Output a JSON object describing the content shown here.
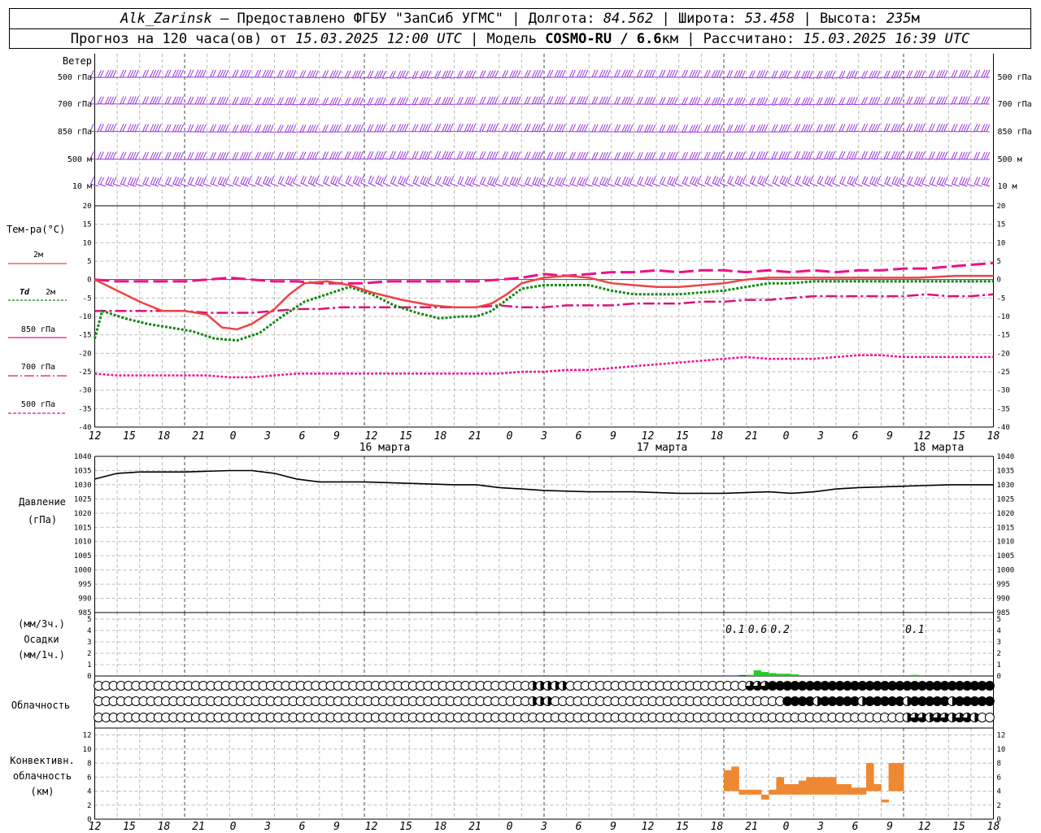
{
  "header": {
    "station": "Alk_Zarinsk",
    "provider": " – Предоставлено ФГБУ \"ЗапСиб УГМС\" | Долгота: ",
    "lon": "84.562",
    "lat_label": " | Широта: ",
    "lat": "53.458",
    "alt_label": " | Высота: ",
    "alt": "235",
    "alt_unit": "м",
    "forecast_label": "Прогноз на 120 часа(ов) от ",
    "start": "15.03.2025 12:00 UTC",
    "model_label": "  | Модель ",
    "model": "COSMO-RU / 6.6",
    "model_unit": "км",
    "calc_label": " | Рассчитано: ",
    "calc": "15.03.2025 16:39 UTC"
  },
  "labels": {
    "wind": "Ветер",
    "levels": [
      "500 гПа",
      "700 гПа",
      "850 гПа",
      "500 м",
      "10  м"
    ],
    "temp": "Тем-ра(°С)",
    "legend_2m": "2м",
    "legend_td": "Td",
    "legend_td2": "2м",
    "legend_850": "850 гПа",
    "legend_700": "700 гПа",
    "legend_500": "500 гПа",
    "pressure": "Давление",
    "pressure_unit": "(гПа)",
    "precip_3h": "(мм/3ч.)",
    "precip": "Осадки",
    "precip_1h": "(мм/1ч.)",
    "clouds": "Облачность",
    "conv1": "Конвективн.",
    "conv2": "облачность",
    "conv3": "(км)",
    "day16": "16 марта",
    "day17": "17 марта",
    "day18": "18 марта"
  },
  "colors": {
    "wind": "#9933dd",
    "t2m": "#ee4444",
    "td2m": "#118811",
    "t850": "#ee1188",
    "t700": "#dd1177",
    "t500": "#ee1199",
    "pressure": "#000000",
    "precip_green": "#22cc22",
    "precip_blue": "#2233cc",
    "convective": "#ee8833",
    "grid": "#bbbbbb"
  },
  "chart_data": {
    "type": "meteogram",
    "x_hours": [
      0,
      120
    ],
    "x_tick_labels": [
      "12",
      "15",
      "18",
      "21",
      "0",
      "3",
      "6",
      "9",
      "12",
      "15",
      "18",
      "21",
      "0",
      "3",
      "6",
      "9",
      "12",
      "15",
      "18",
      "21",
      "0",
      "3",
      "6",
      "9",
      "12",
      "15",
      "18"
    ],
    "temperature": {
      "ylim": [
        -40,
        20
      ],
      "yticks": [
        -40,
        -35,
        -30,
        -25,
        -20,
        -15,
        -10,
        -5,
        0,
        5,
        10,
        15,
        20
      ],
      "t2m": [
        [
          0,
          0
        ],
        [
          3,
          -3
        ],
        [
          6,
          -6
        ],
        [
          9,
          -8.5
        ],
        [
          12,
          -8.5
        ],
        [
          15,
          -9.5
        ],
        [
          17,
          -13
        ],
        [
          19,
          -13.5
        ],
        [
          21,
          -12
        ],
        [
          24,
          -8
        ],
        [
          26,
          -4
        ],
        [
          28,
          -1
        ],
        [
          31,
          -0.5
        ],
        [
          34,
          -1.5
        ],
        [
          37,
          -3.5
        ],
        [
          41,
          -5.5
        ],
        [
          45,
          -7
        ],
        [
          48,
          -7.5
        ],
        [
          51,
          -7.5
        ],
        [
          53,
          -6.5
        ],
        [
          55,
          -4
        ],
        [
          57,
          -1
        ],
        [
          60,
          0.5
        ],
        [
          63,
          1
        ],
        [
          66,
          0.5
        ],
        [
          69,
          -1
        ],
        [
          72,
          -1.5
        ],
        [
          75,
          -2
        ],
        [
          78,
          -2
        ],
        [
          81,
          -1.5
        ],
        [
          84,
          -1
        ],
        [
          87,
          0
        ],
        [
          90,
          0.5
        ],
        [
          93,
          0.5
        ],
        [
          96,
          0.5
        ],
        [
          100,
          0.5
        ],
        [
          105,
          0.5
        ],
        [
          110,
          0.5
        ],
        [
          115,
          1
        ],
        [
          120,
          1
        ]
      ],
      "td2m": [
        [
          0,
          -16
        ],
        [
          1,
          -8.5
        ],
        [
          4,
          -10.5
        ],
        [
          7,
          -12
        ],
        [
          10,
          -13
        ],
        [
          13,
          -14
        ],
        [
          16,
          -16
        ],
        [
          19,
          -16.5
        ],
        [
          22,
          -14.5
        ],
        [
          25,
          -10
        ],
        [
          28,
          -6
        ],
        [
          31,
          -4
        ],
        [
          34,
          -2
        ],
        [
          37,
          -4
        ],
        [
          40,
          -7
        ],
        [
          43,
          -9
        ],
        [
          46,
          -10.5
        ],
        [
          49,
          -10
        ],
        [
          51,
          -10
        ],
        [
          53,
          -8.5
        ],
        [
          55,
          -5.5
        ],
        [
          57,
          -2.5
        ],
        [
          60,
          -1.5
        ],
        [
          63,
          -1.5
        ],
        [
          66,
          -1.5
        ],
        [
          69,
          -3
        ],
        [
          72,
          -4
        ],
        [
          75,
          -4
        ],
        [
          78,
          -4
        ],
        [
          81,
          -3.5
        ],
        [
          84,
          -3
        ],
        [
          87,
          -2
        ],
        [
          90,
          -1
        ],
        [
          93,
          -1
        ],
        [
          96,
          -0.5
        ],
        [
          100,
          -0.5
        ],
        [
          105,
          -0.5
        ],
        [
          110,
          -0.5
        ],
        [
          115,
          -0.5
        ],
        [
          120,
          -0.5
        ]
      ],
      "t850": [
        [
          0,
          0
        ],
        [
          3,
          -0.5
        ],
        [
          6,
          -0.5
        ],
        [
          9,
          -0.5
        ],
        [
          12,
          -0.5
        ],
        [
          15,
          0
        ],
        [
          18,
          0.5
        ],
        [
          21,
          0
        ],
        [
          24,
          -0.5
        ],
        [
          27,
          -0.5
        ],
        [
          30,
          -1
        ],
        [
          33,
          -1
        ],
        [
          36,
          -1
        ],
        [
          39,
          -0.5
        ],
        [
          42,
          -0.5
        ],
        [
          45,
          -0.5
        ],
        [
          48,
          -0.5
        ],
        [
          51,
          -0.5
        ],
        [
          54,
          0
        ],
        [
          57,
          0.5
        ],
        [
          60,
          1.5
        ],
        [
          63,
          1
        ],
        [
          66,
          1.5
        ],
        [
          69,
          2
        ],
        [
          72,
          2
        ],
        [
          75,
          2.5
        ],
        [
          78,
          2
        ],
        [
          81,
          2.5
        ],
        [
          84,
          2.5
        ],
        [
          87,
          2
        ],
        [
          90,
          2.5
        ],
        [
          93,
          2
        ],
        [
          96,
          2.5
        ],
        [
          99,
          2
        ],
        [
          102,
          2.5
        ],
        [
          105,
          2.5
        ],
        [
          108,
          3
        ],
        [
          111,
          3
        ],
        [
          114,
          3.5
        ],
        [
          117,
          4
        ],
        [
          120,
          4.5
        ]
      ],
      "t700": [
        [
          0,
          -8.5
        ],
        [
          3,
          -8.5
        ],
        [
          6,
          -8.5
        ],
        [
          9,
          -8.5
        ],
        [
          12,
          -8.5
        ],
        [
          15,
          -9
        ],
        [
          18,
          -9
        ],
        [
          21,
          -9
        ],
        [
          24,
          -8.5
        ],
        [
          27,
          -8
        ],
        [
          30,
          -8
        ],
        [
          33,
          -7.5
        ],
        [
          36,
          -7.5
        ],
        [
          39,
          -7.5
        ],
        [
          42,
          -7.5
        ],
        [
          45,
          -7.5
        ],
        [
          48,
          -7.5
        ],
        [
          51,
          -7.5
        ],
        [
          54,
          -7
        ],
        [
          57,
          -7.5
        ],
        [
          60,
          -7.5
        ],
        [
          63,
          -7
        ],
        [
          66,
          -7
        ],
        [
          69,
          -7
        ],
        [
          72,
          -6.5
        ],
        [
          75,
          -6.5
        ],
        [
          78,
          -6.5
        ],
        [
          81,
          -6
        ],
        [
          84,
          -6
        ],
        [
          87,
          -5.5
        ],
        [
          90,
          -5.5
        ],
        [
          93,
          -5
        ],
        [
          96,
          -4.5
        ],
        [
          99,
          -4.5
        ],
        [
          102,
          -4.5
        ],
        [
          105,
          -4.5
        ],
        [
          108,
          -4.5
        ],
        [
          111,
          -4
        ],
        [
          114,
          -4.5
        ],
        [
          117,
          -4.5
        ],
        [
          120,
          -4
        ]
      ],
      "t500": [
        [
          0,
          -25.5
        ],
        [
          3,
          -26
        ],
        [
          6,
          -26
        ],
        [
          9,
          -26
        ],
        [
          12,
          -26
        ],
        [
          15,
          -26
        ],
        [
          18,
          -26.5
        ],
        [
          21,
          -26.5
        ],
        [
          24,
          -26
        ],
        [
          27,
          -25.5
        ],
        [
          30,
          -25.5
        ],
        [
          33,
          -25.5
        ],
        [
          36,
          -25.5
        ],
        [
          39,
          -25.5
        ],
        [
          42,
          -25.5
        ],
        [
          45,
          -25.5
        ],
        [
          48,
          -25.5
        ],
        [
          51,
          -25.5
        ],
        [
          54,
          -25.5
        ],
        [
          57,
          -25
        ],
        [
          60,
          -25
        ],
        [
          63,
          -24.5
        ],
        [
          66,
          -24.5
        ],
        [
          69,
          -24
        ],
        [
          72,
          -23.5
        ],
        [
          75,
          -23
        ],
        [
          78,
          -22.5
        ],
        [
          81,
          -22
        ],
        [
          84,
          -21.5
        ],
        [
          87,
          -21
        ],
        [
          90,
          -21.5
        ],
        [
          93,
          -21.5
        ],
        [
          96,
          -21.5
        ],
        [
          99,
          -21
        ],
        [
          102,
          -20.5
        ],
        [
          105,
          -20.5
        ],
        [
          108,
          -21
        ],
        [
          111,
          -21
        ],
        [
          114,
          -21
        ],
        [
          117,
          -21
        ],
        [
          120,
          -21
        ]
      ]
    },
    "pressure": {
      "ylim": [
        985,
        1040
      ],
      "yticks": [
        985,
        990,
        995,
        1000,
        1005,
        1010,
        1015,
        1020,
        1025,
        1030,
        1035,
        1040
      ],
      "values": [
        [
          0,
          1032
        ],
        [
          3,
          1034
        ],
        [
          6,
          1034.5
        ],
        [
          12,
          1034.5
        ],
        [
          18,
          1035
        ],
        [
          21,
          1035
        ],
        [
          24,
          1034
        ],
        [
          27,
          1032
        ],
        [
          30,
          1031
        ],
        [
          36,
          1031
        ],
        [
          42,
          1030.5
        ],
        [
          48,
          1030
        ],
        [
          51,
          1030
        ],
        [
          54,
          1029
        ],
        [
          57,
          1028.5
        ],
        [
          60,
          1028
        ],
        [
          66,
          1027.5
        ],
        [
          72,
          1027.5
        ],
        [
          78,
          1027
        ],
        [
          84,
          1027
        ],
        [
          90,
          1027.5
        ],
        [
          93,
          1027
        ],
        [
          96,
          1027.5
        ],
        [
          99,
          1028.5
        ],
        [
          102,
          1029
        ],
        [
          108,
          1029.5
        ],
        [
          114,
          1030
        ],
        [
          120,
          1030
        ]
      ]
    },
    "precip": {
      "ylim": [
        0,
        5
      ],
      "yticks": [
        0,
        1,
        2,
        3,
        4,
        5
      ],
      "labels_3h": [
        {
          "h": 85.5,
          "text": "0.1"
        },
        {
          "h": 88.5,
          "text": "0.6"
        },
        {
          "h": 91.5,
          "text": "0.2"
        },
        {
          "h": 109.5,
          "text": "0.1"
        }
      ],
      "bars": [
        [
          84,
          0.05,
          "blue"
        ],
        [
          85,
          0.05,
          "blue"
        ],
        [
          86,
          0.08,
          "blue"
        ],
        [
          87,
          0.1,
          "green"
        ],
        [
          88,
          0.5,
          "green"
        ],
        [
          89,
          0.35,
          "green"
        ],
        [
          90,
          0.25,
          "green"
        ],
        [
          91,
          0.2,
          "green"
        ],
        [
          92,
          0.2,
          "green"
        ],
        [
          93,
          0.15,
          "green"
        ],
        [
          109,
          0.1,
          "green"
        ]
      ]
    },
    "clouds": {
      "rows": 3,
      "per_hour": 1,
      "low": [],
      "mid": [],
      "high": []
    },
    "convective": {
      "ylim": [
        0,
        13
      ],
      "yticks": [
        0,
        2,
        4,
        6,
        8,
        10,
        12
      ],
      "bars": [
        [
          84,
          4,
          7
        ],
        [
          85,
          4,
          7.5
        ],
        [
          86,
          3.5,
          4.2
        ],
        [
          87,
          3.5,
          4.2
        ],
        [
          88,
          3.5,
          4.2
        ],
        [
          89,
          2.8,
          3.5
        ],
        [
          90,
          3.5,
          4.2
        ],
        [
          91,
          3.5,
          6
        ],
        [
          92,
          3.5,
          5
        ],
        [
          93,
          3.5,
          5
        ],
        [
          94,
          3.5,
          5.5
        ],
        [
          95,
          3.5,
          6
        ],
        [
          96,
          3.5,
          6
        ],
        [
          97,
          3.5,
          6
        ],
        [
          98,
          3.5,
          6
        ],
        [
          99,
          3.5,
          5
        ],
        [
          100,
          3.5,
          5
        ],
        [
          101,
          3.5,
          4.5
        ],
        [
          102,
          3.5,
          4.5
        ],
        [
          103,
          4,
          8
        ],
        [
          104,
          4,
          5
        ],
        [
          105,
          2.4,
          2.8
        ],
        [
          106,
          4,
          8
        ],
        [
          107,
          4,
          8
        ]
      ]
    }
  }
}
